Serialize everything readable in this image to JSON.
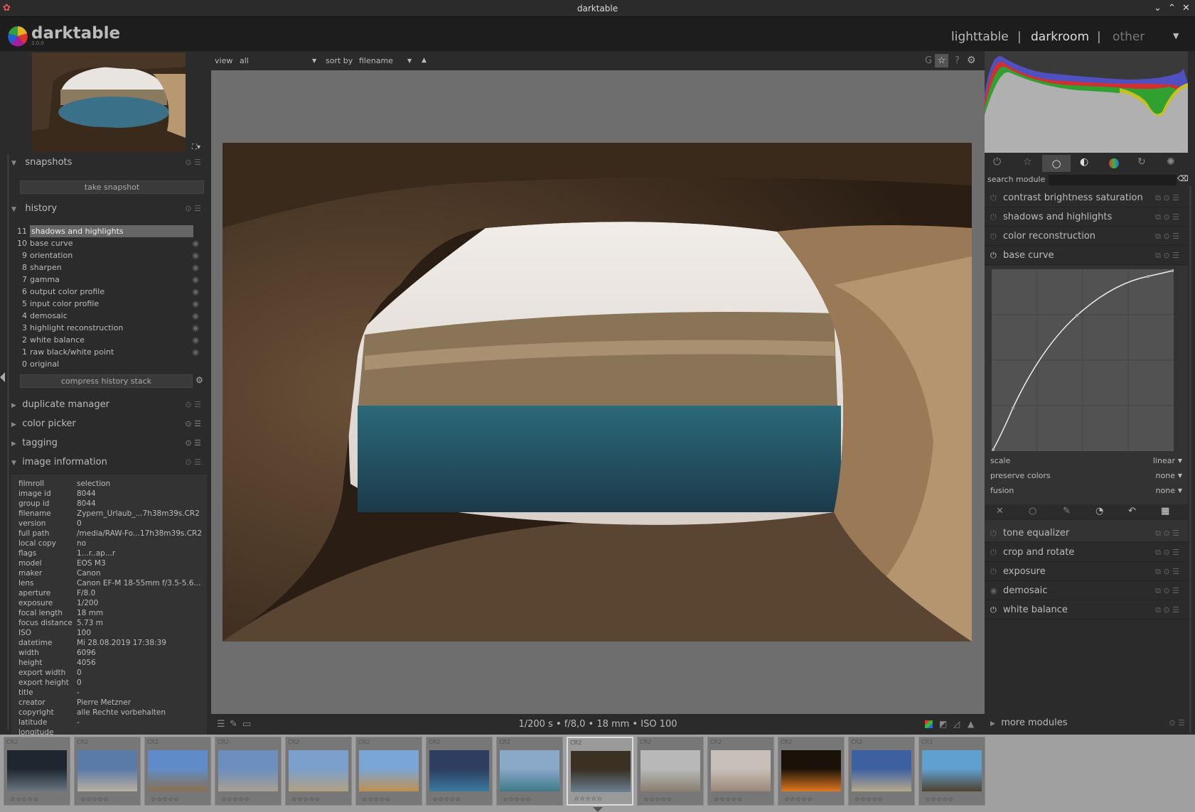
{
  "window": {
    "title": "darktable"
  },
  "app": {
    "name": "darktable",
    "version": "3.0.0"
  },
  "views": {
    "lighttable": "lighttable",
    "sep1": "|",
    "darkroom": "darkroom",
    "sep2": "|",
    "other": "other"
  },
  "toolbar": {
    "view_label": "view",
    "view_value": "all",
    "sort_label": "sort by",
    "sort_value": "filename",
    "g_label": "G",
    "help_label": "?"
  },
  "left": {
    "snapshots": {
      "title": "snapshots",
      "button": "take snapshot"
    },
    "history": {
      "title": "history",
      "items": [
        {
          "num": "11",
          "label": "shadows and highlights"
        },
        {
          "num": "10",
          "label": "base curve"
        },
        {
          "num": "9",
          "label": "orientation"
        },
        {
          "num": "8",
          "label": "sharpen"
        },
        {
          "num": "7",
          "label": "gamma"
        },
        {
          "num": "6",
          "label": "output color profile"
        },
        {
          "num": "5",
          "label": "input color profile"
        },
        {
          "num": "4",
          "label": "demosaic"
        },
        {
          "num": "3",
          "label": "highlight reconstruction"
        },
        {
          "num": "2",
          "label": "white balance"
        },
        {
          "num": "1",
          "label": "raw black/white point"
        },
        {
          "num": "0",
          "label": "original"
        }
      ],
      "compress": "compress history stack"
    },
    "duplicate": "duplicate manager",
    "colorpicker": "color picker",
    "tagging": "tagging",
    "imageinfo": {
      "title": "image information",
      "rows": [
        {
          "k": "filmroll",
          "v": "selection"
        },
        {
          "k": "image id",
          "v": "8044"
        },
        {
          "k": "group id",
          "v": "8044"
        },
        {
          "k": "filename",
          "v": "Zypern_Urlaub_...7h38m39s.CR2"
        },
        {
          "k": "version",
          "v": "0"
        },
        {
          "k": "full path",
          "v": "/media/RAW-Fo...17h38m39s.CR2"
        },
        {
          "k": "local copy",
          "v": "no"
        },
        {
          "k": "flags",
          "v": "1...r..ap...r"
        },
        {
          "k": "model",
          "v": "EOS M3"
        },
        {
          "k": "maker",
          "v": "Canon"
        },
        {
          "k": "lens",
          "v": "Canon EF-M 18-55mm f/3.5-5.6..."
        },
        {
          "k": "aperture",
          "v": "F/8.0"
        },
        {
          "k": "exposure",
          "v": "1/200"
        },
        {
          "k": "focal length",
          "v": "18 mm"
        },
        {
          "k": "focus distance",
          "v": "5.73 m"
        },
        {
          "k": "ISO",
          "v": "100"
        },
        {
          "k": "datetime",
          "v": "Mi 28.08.2019 17:38:39"
        },
        {
          "k": "width",
          "v": "6096"
        },
        {
          "k": "height",
          "v": "4056"
        },
        {
          "k": "export width",
          "v": "0"
        },
        {
          "k": "export height",
          "v": "0"
        },
        {
          "k": "title",
          "v": "-"
        },
        {
          "k": "creator",
          "v": "Pierre Metzner"
        },
        {
          "k": "copyright",
          "v": "alle Rechte vorbehalten"
        },
        {
          "k": "latitude",
          "v": "-"
        },
        {
          "k": "longitude",
          "v": ""
        }
      ]
    }
  },
  "right": {
    "search_label": "search module",
    "modules": [
      "contrast brightness saturation",
      "shadows and highlights",
      "color reconstruction",
      "base curve"
    ],
    "basecurve": {
      "scale_label": "scale",
      "scale_value": "linear",
      "preserve_label": "preserve colors",
      "preserve_value": "none",
      "fusion_label": "fusion",
      "fusion_value": "none"
    },
    "modules2": [
      "tone equalizer",
      "crop and rotate",
      "exposure",
      "demosaic",
      "white balance"
    ],
    "more": "more modules"
  },
  "exif_line": "1/200 s • f/8,0 • 18 mm • ISO 100",
  "filmstrip": {
    "cr_label": "CR2",
    "stars": "☆☆☆☆☆",
    "thumbs": [
      {
        "c1": "#1e2630",
        "c2": "#6a7680"
      },
      {
        "c1": "#5a7aa8",
        "c2": "#b8b0a0"
      },
      {
        "c1": "#5f8cc8",
        "c2": "#8a7050"
      },
      {
        "c1": "#6c8fc0",
        "c2": "#a8a090"
      },
      {
        "c1": "#7ca0cc",
        "c2": "#b0a080"
      },
      {
        "c1": "#7aa6d6",
        "c2": "#c09050"
      },
      {
        "c1": "#2e3e60",
        "c2": "#3a7aa0"
      },
      {
        "c1": "#8aa8c8",
        "c2": "#3e7a8a"
      },
      {
        "c1": "#3a3024",
        "c2": "#6a8090"
      },
      {
        "c1": "#b8b8b8",
        "c2": "#8a8070"
      },
      {
        "c1": "#c8c0b8",
        "c2": "#9a8878"
      },
      {
        "c1": "#1a1208",
        "c2": "#e07820"
      },
      {
        "c1": "#3c60a0",
        "c2": "#b8a890"
      },
      {
        "c1": "#60a0d0",
        "c2": "#504030"
      }
    ]
  },
  "colors": {
    "panel": "#2b2b2b",
    "bg": "#1d1d1d",
    "canvas": "#6e6e6e",
    "filmstrip": "#a0a0a0"
  }
}
